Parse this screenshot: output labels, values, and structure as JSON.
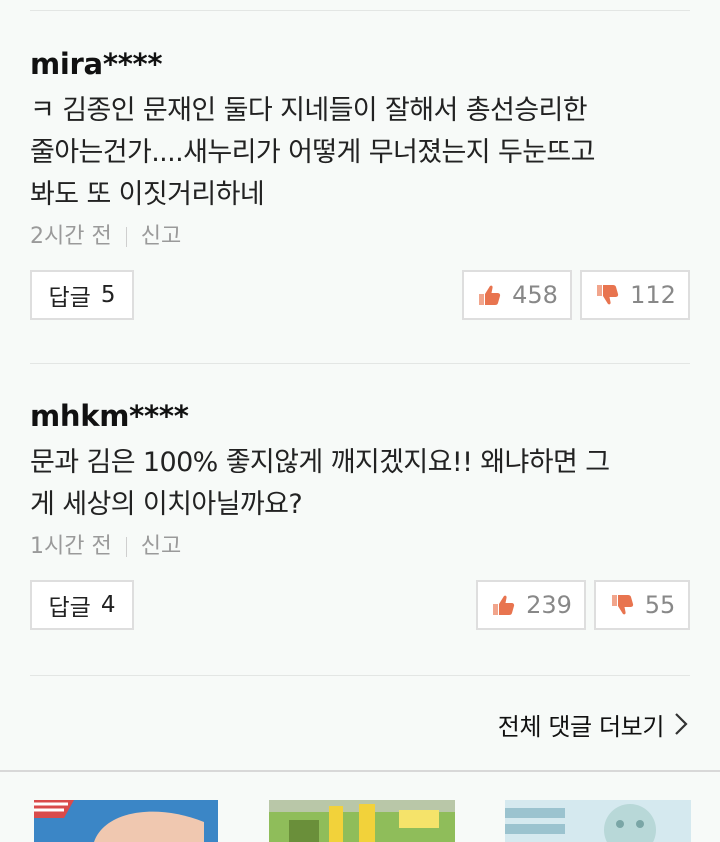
{
  "comments": [
    {
      "author": "mira****",
      "lines": [
        "ㅋ 김종인 문재인 둘다 지네들이 잘해서 총선승리한",
        "줄아는건가....새누리가 어떻게 무너졌는지 두눈뜨고",
        "봐도 또 이짓거리하네"
      ],
      "time": "2시간 전",
      "report": "신고",
      "reply_label": "답글",
      "reply_count": "5",
      "likes": "458",
      "dislikes": "112"
    },
    {
      "author": "mhkm****",
      "lines": [
        "문과 김은 100% 좋지않게 깨지겠지요!! 왜냐하면 그",
        "게 세상의 이치아닐까요?"
      ],
      "time": "1시간 전",
      "report": "신고",
      "reply_label": "답글",
      "reply_count": "4",
      "likes": "239",
      "dislikes": "55"
    }
  ],
  "more_comments_label": "전체 댓글 더보기",
  "colors": {
    "background": "#f7faf8",
    "thumb_up": "#e8744f",
    "thumb_down": "#e8744f"
  }
}
